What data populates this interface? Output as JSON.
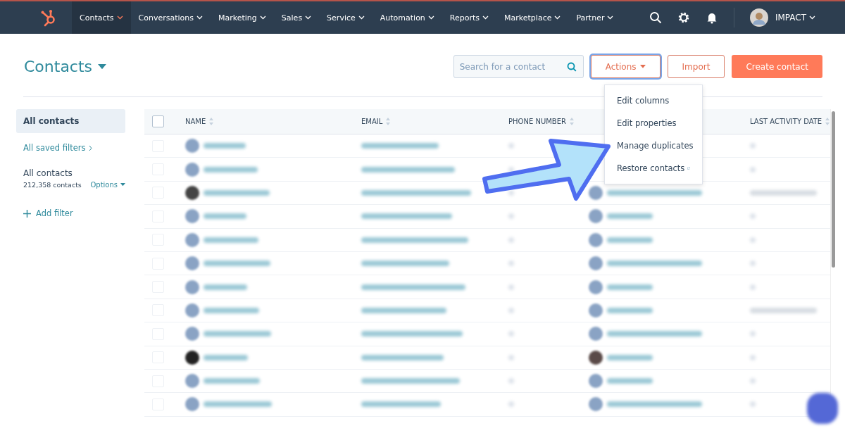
{
  "nav": {
    "items": [
      {
        "label": "Contacts",
        "selected": true
      },
      {
        "label": "Conversations",
        "selected": false
      },
      {
        "label": "Marketing",
        "selected": false
      },
      {
        "label": "Sales",
        "selected": false
      },
      {
        "label": "Service",
        "selected": false
      },
      {
        "label": "Automation",
        "selected": false
      },
      {
        "label": "Reports",
        "selected": false
      },
      {
        "label": "Marketplace",
        "selected": false
      },
      {
        "label": "Partner",
        "selected": false
      }
    ],
    "account": "IMPACT"
  },
  "header": {
    "title": "Contacts",
    "search": {
      "placeholder": "Search for a contact"
    },
    "actions": "Actions",
    "import": "Import",
    "create": "Create contact"
  },
  "actions_menu": {
    "items": [
      "Edit columns",
      "Edit properties",
      "Manage duplicates",
      "Restore contacts"
    ]
  },
  "sidebar": {
    "view": "All contacts",
    "saved_filters": "All saved filters",
    "current": "All contacts",
    "count": "212,358 contacts",
    "options": "Options",
    "add_filter": "Add filter"
  },
  "table": {
    "columns": [
      "NAME",
      "EMAIL",
      "PHONE NUMBER",
      "LAST ACTIVITY DATE"
    ],
    "select_all": {
      "checked": false
    },
    "rows": [
      {
        "checked": false,
        "last_activity": false
      },
      {
        "checked": false,
        "last_activity": false
      },
      {
        "checked": false,
        "last_activity": true
      },
      {
        "checked": false,
        "last_activity": false
      },
      {
        "checked": false,
        "last_activity": false
      },
      {
        "checked": false,
        "last_activity": false
      },
      {
        "checked": false,
        "last_activity": false
      },
      {
        "checked": false,
        "last_activity": true
      },
      {
        "checked": false,
        "last_activity": false
      },
      {
        "checked": false,
        "last_activity": false
      },
      {
        "checked": false,
        "last_activity": false
      },
      {
        "checked": false,
        "last_activity": false
      }
    ]
  }
}
